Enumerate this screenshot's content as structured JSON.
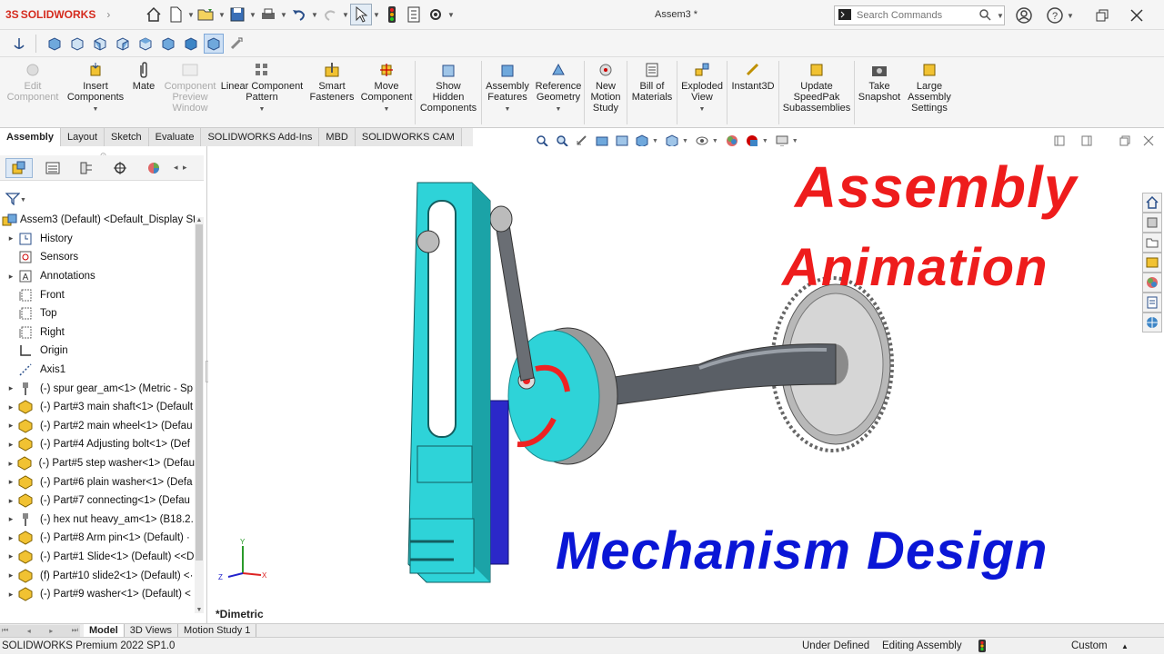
{
  "app": {
    "logo_prefix": "3S",
    "logo_name": "SOLIDWORKS",
    "doc_title": "Assem3 *"
  },
  "search": {
    "placeholder": "Search Commands"
  },
  "ribbon": {
    "buttons": [
      {
        "label1": "Edit",
        "label2": "Component",
        "label3": "",
        "disabled": true
      },
      {
        "label1": "Insert",
        "label2": "Components",
        "label3": ""
      },
      {
        "label1": "Mate",
        "label2": "",
        "label3": ""
      },
      {
        "label1": "Component",
        "label2": "Preview",
        "label3": "Window",
        "disabled": true
      },
      {
        "label1": "Linear Component",
        "label2": "Pattern",
        "label3": ""
      },
      {
        "label1": "Smart",
        "label2": "Fasteners",
        "label3": ""
      },
      {
        "label1": "Move",
        "label2": "Component",
        "label3": ""
      },
      {
        "label1": "Show",
        "label2": "Hidden",
        "label3": "Components"
      },
      {
        "label1": "Assembly",
        "label2": "Features",
        "label3": ""
      },
      {
        "label1": "Reference",
        "label2": "Geometry",
        "label3": ""
      },
      {
        "label1": "New",
        "label2": "Motion",
        "label3": "Study"
      },
      {
        "label1": "Bill of",
        "label2": "Materials",
        "label3": ""
      },
      {
        "label1": "Exploded",
        "label2": "View",
        "label3": ""
      },
      {
        "label1": "Instant3D",
        "label2": "",
        "label3": ""
      },
      {
        "label1": "Update",
        "label2": "SpeedPak",
        "label3": "Subassemblies"
      },
      {
        "label1": "Take",
        "label2": "Snapshot",
        "label3": ""
      },
      {
        "label1": "Large",
        "label2": "Assembly",
        "label3": "Settings"
      }
    ]
  },
  "command_tabs": [
    "Assembly",
    "Layout",
    "Sketch",
    "Evaluate",
    "SOLIDWORKS Add-Ins",
    "MBD",
    "SOLIDWORKS CAM"
  ],
  "tree": {
    "root": "Assem3 (Default) <Default_Display Sta",
    "items": [
      {
        "label": "History",
        "icon": "history-icon",
        "exp": "▸"
      },
      {
        "label": "Sensors",
        "icon": "sensors-icon",
        "exp": ""
      },
      {
        "label": "Annotations",
        "icon": "annotations-icon",
        "exp": "▸"
      },
      {
        "label": "Front",
        "icon": "plane-icon",
        "exp": ""
      },
      {
        "label": "Top",
        "icon": "plane-icon",
        "exp": ""
      },
      {
        "label": "Right",
        "icon": "plane-icon",
        "exp": ""
      },
      {
        "label": "Origin",
        "icon": "origin-icon",
        "exp": ""
      },
      {
        "label": "Axis1",
        "icon": "axis-icon",
        "exp": ""
      },
      {
        "label": "(-) spur gear_am<1> (Metric - Sp",
        "icon": "toolbox-part-icon",
        "exp": "▸"
      },
      {
        "label": "(-) Part#3 main shaft<1> (Default",
        "icon": "part-icon",
        "exp": "▸"
      },
      {
        "label": "(-) Part#2 main wheel<1> (Defau",
        "icon": "part-icon",
        "exp": "▸"
      },
      {
        "label": "(-) Part#4 Adjusting bolt<1> (Def",
        "icon": "part-icon",
        "exp": "▸"
      },
      {
        "label": "(-) Part#5 step washer<1> (Defau",
        "icon": "part-icon",
        "exp": "▸"
      },
      {
        "label": "(-) Part#6 plain washer<1> (Defa",
        "icon": "part-icon",
        "exp": "▸"
      },
      {
        "label": "(-) Part#7 connecting<1> (Defau",
        "icon": "part-icon",
        "exp": "▸"
      },
      {
        "label": "(-) hex nut heavy_am<1> (B18.2.",
        "icon": "toolbox-part-icon",
        "exp": "▸"
      },
      {
        "label": "(-) Part#8 Arm pin<1> (Default) ·",
        "icon": "part-icon",
        "exp": "▸"
      },
      {
        "label": "(-) Part#1 Slide<1> (Default) <<D",
        "icon": "part-icon",
        "exp": "▸"
      },
      {
        "label": "(f) Part#10 slide2<1> (Default) <·",
        "icon": "part-icon",
        "exp": "▸"
      },
      {
        "label": "(-) Part#9 washer<1> (Default) <",
        "icon": "part-icon",
        "exp": "▸"
      }
    ]
  },
  "graphics": {
    "title_line1": "Assembly",
    "title_line2": "Animation",
    "title_line3": "Mechanism Design",
    "view_label": "*Dimetric",
    "colors": {
      "red_text": "#ee1c1c",
      "blue_text": "#0a16d6",
      "cyan_part": "#2ed3d8",
      "blue_part": "#2b28c9"
    }
  },
  "bottom_tabs": [
    "Model",
    "3D Views",
    "Motion Study 1"
  ],
  "status": {
    "product": "SOLIDWORKS Premium 2022 SP1.0",
    "defined": "Under Defined",
    "mode": "Editing Assembly",
    "units": "Custom"
  }
}
